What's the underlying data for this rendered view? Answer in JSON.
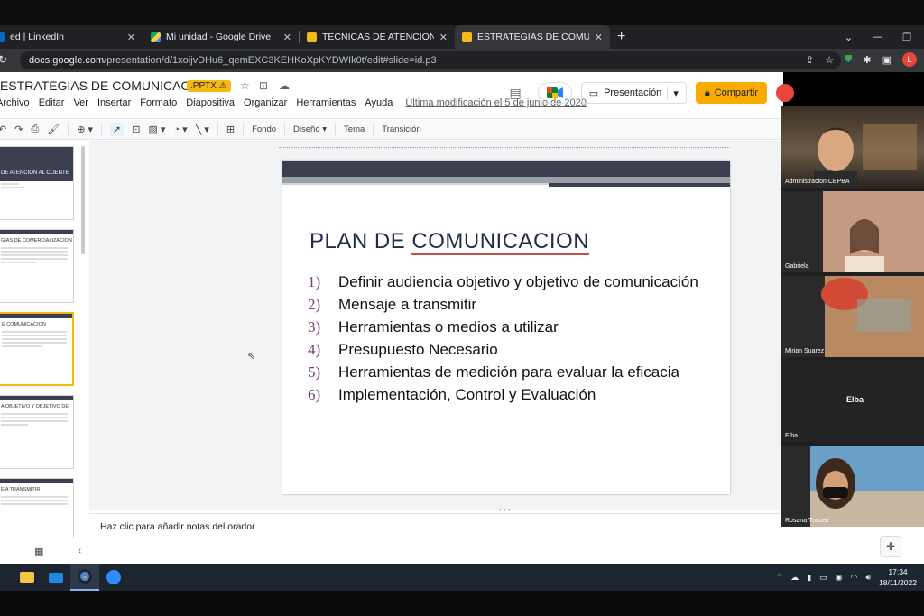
{
  "browser": {
    "tabs": [
      {
        "title": "ed | LinkedIn",
        "favicon_color": "#0a66c2",
        "active": false
      },
      {
        "title": "Mi unidad - Google Drive",
        "favicon_color": "#1fa463",
        "active": false
      },
      {
        "title": "TECNICAS DE ATENCION AL CLIE",
        "favicon_color": "#f6b913",
        "active": false
      },
      {
        "title": "ESTRATEGIAS DE COMUNICACIO",
        "favicon_color": "#f6b913",
        "active": true
      }
    ],
    "url_host": "docs.google.com",
    "url_path": "/presentation/d/1xoijvDHu6_qemEXC3KEHKoXpKYDWIk0t/edit#slide=id.p3",
    "profile_initial": "L"
  },
  "docs": {
    "title": "ESTRATEGIAS DE COMUNICACION",
    "file_badge": ".PPTX",
    "menus": [
      "Archivo",
      "Editar",
      "Ver",
      "Insertar",
      "Formato",
      "Diapositiva",
      "Organizar",
      "Herramientas",
      "Ayuda"
    ],
    "last_modified": "Última modificación el 5 de junio de 2020",
    "present_label": "Presentación",
    "share_label": "Compartir",
    "toolbar": {
      "fondo": "Fondo",
      "diseno": "Diseño",
      "tema": "Tema",
      "transicion": "Transición"
    },
    "notes_placeholder": "Haz clic para añadir notas del orador"
  },
  "filmstrip": [
    {
      "title": "DE ATENCION AL CLIENTE",
      "type": "title-slide"
    },
    {
      "title": "GIAS DE COMERCIALIZACION",
      "type": "text"
    },
    {
      "title": "E COMUNICACION",
      "type": "text",
      "selected": true
    },
    {
      "title": "A OBJETIVO Y OBJETIVO DE",
      "type": "text"
    },
    {
      "title": "E A TRANSMITIR",
      "type": "text"
    }
  ],
  "slide": {
    "title": "PLAN DE COMUNICACION",
    "title_underlined": "COMUNICACION",
    "items": [
      {
        "num": "1)",
        "text": "Definir audiencia objetivo y objetivo de comunicación"
      },
      {
        "num": "2)",
        "text": "Mensaje a transmitir"
      },
      {
        "num": "3)",
        "text": "Herramientas o medios a utilizar"
      },
      {
        "num": "4)",
        "text": "Presupuesto Necesario"
      },
      {
        "num": "5)",
        "text": "Herramientas de medición para evaluar la eficacia"
      },
      {
        "num": "6)",
        "text": "Implementación, Control y Evaluación"
      }
    ]
  },
  "meeting": {
    "participants": [
      {
        "name": "Administracion CEPBA",
        "bg": "#6b5a46"
      },
      {
        "name": "Gabriela",
        "bg": "#b9856b"
      },
      {
        "name": "Mirian Suarez",
        "bg": "#8a6b55"
      },
      {
        "name": "Elba",
        "bg": "#232323",
        "center_label": "Elba"
      },
      {
        "name": "Rosana Tucceri",
        "bg": "#3b6c8f"
      }
    ]
  },
  "taskbar": {
    "time": "17:34",
    "date": "18/11/2022"
  }
}
